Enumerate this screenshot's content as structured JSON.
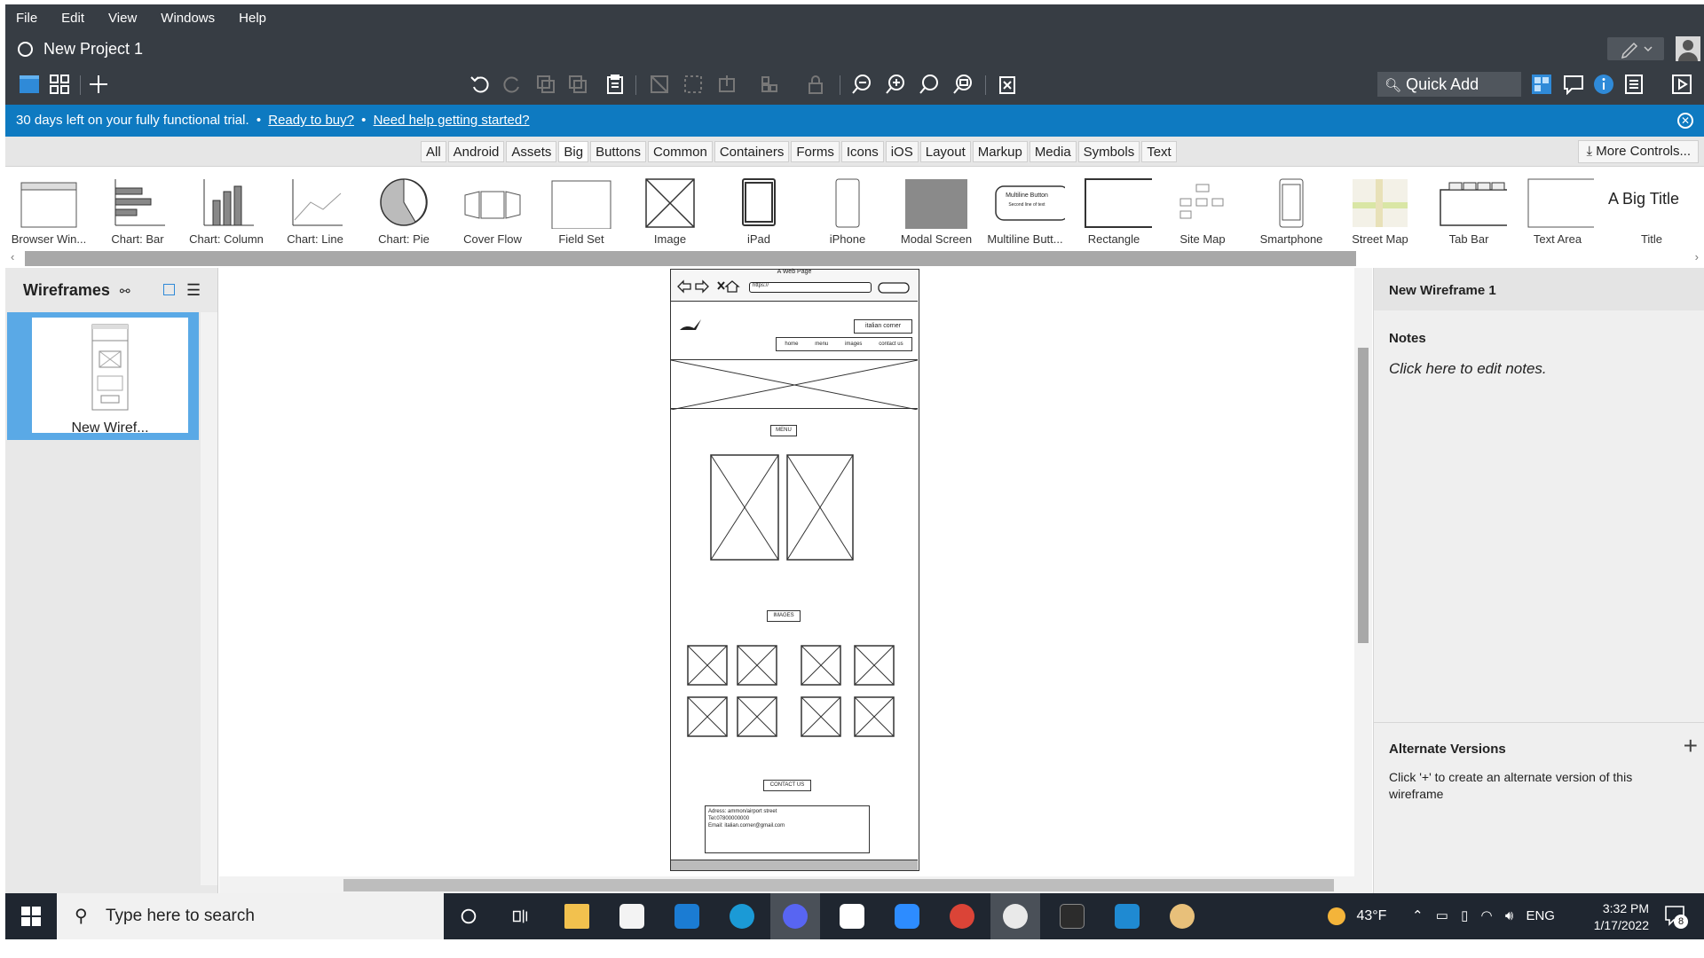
{
  "menu": {
    "items": [
      "File",
      "Edit",
      "View",
      "Windows",
      "Help"
    ]
  },
  "project": {
    "title": "New Project 1"
  },
  "toolbar": {
    "quick_add": "Quick Add"
  },
  "banner": {
    "text": "30 days left on your fully functional trial.",
    "sep": "•",
    "buy": "Ready to buy?",
    "help": "Need help getting started?"
  },
  "categories": {
    "items": [
      "All",
      "Android",
      "Assets",
      "Big",
      "Buttons",
      "Common",
      "Containers",
      "Forms",
      "Icons",
      "iOS",
      "Layout",
      "Markup",
      "Media",
      "Symbols",
      "Text"
    ],
    "active": "Big",
    "more": "More Controls..."
  },
  "library": {
    "items": [
      "Browser Win...",
      "Chart: Bar",
      "Chart: Column",
      "Chart: Line",
      "Chart: Pie",
      "Cover Flow",
      "Field Set",
      "Image",
      "iPad",
      "iPhone",
      "Modal Screen",
      "Multiline Butt...",
      "Rectangle",
      "Site Map",
      "Smartphone",
      "Street Map",
      "Tab Bar",
      "Text Area",
      "Title"
    ],
    "title_preview": "A Big Title",
    "multiline_line1": "Multiline Button",
    "multiline_line2": "Second line of text"
  },
  "left_panel": {
    "title": "Wireframes",
    "item": "New Wiref..."
  },
  "right_panel": {
    "title": "New Wireframe 1",
    "notes_heading": "Notes",
    "notes_placeholder": "Click here to edit notes.",
    "alt_heading": "Alternate Versions",
    "alt_plus": "+",
    "alt_help": "Click '+' to create an alternate version of this wireframe"
  },
  "wireframe": {
    "page_title": "A Web Page",
    "url": "https://",
    "brand": "italian corner",
    "nav": [
      "home",
      "menu",
      "images",
      "contact us"
    ],
    "menu_label": "MENU",
    "images_label": "IMAGES",
    "contact_label": "CONTACT US",
    "contact_lines": [
      "Adress: ammon/airport street",
      "Tel:07800000000",
      "Email: italian.corner@gmail.com"
    ]
  },
  "taskbar": {
    "search_placeholder": "Type here to search",
    "weather": "43°F",
    "lang": "ENG",
    "time": "3:32 PM",
    "date": "1/17/2022",
    "notif_count": "8"
  },
  "colors": {
    "dark": "#373d44",
    "accent": "#0e7ac1",
    "taskbar": "#1f2630"
  }
}
